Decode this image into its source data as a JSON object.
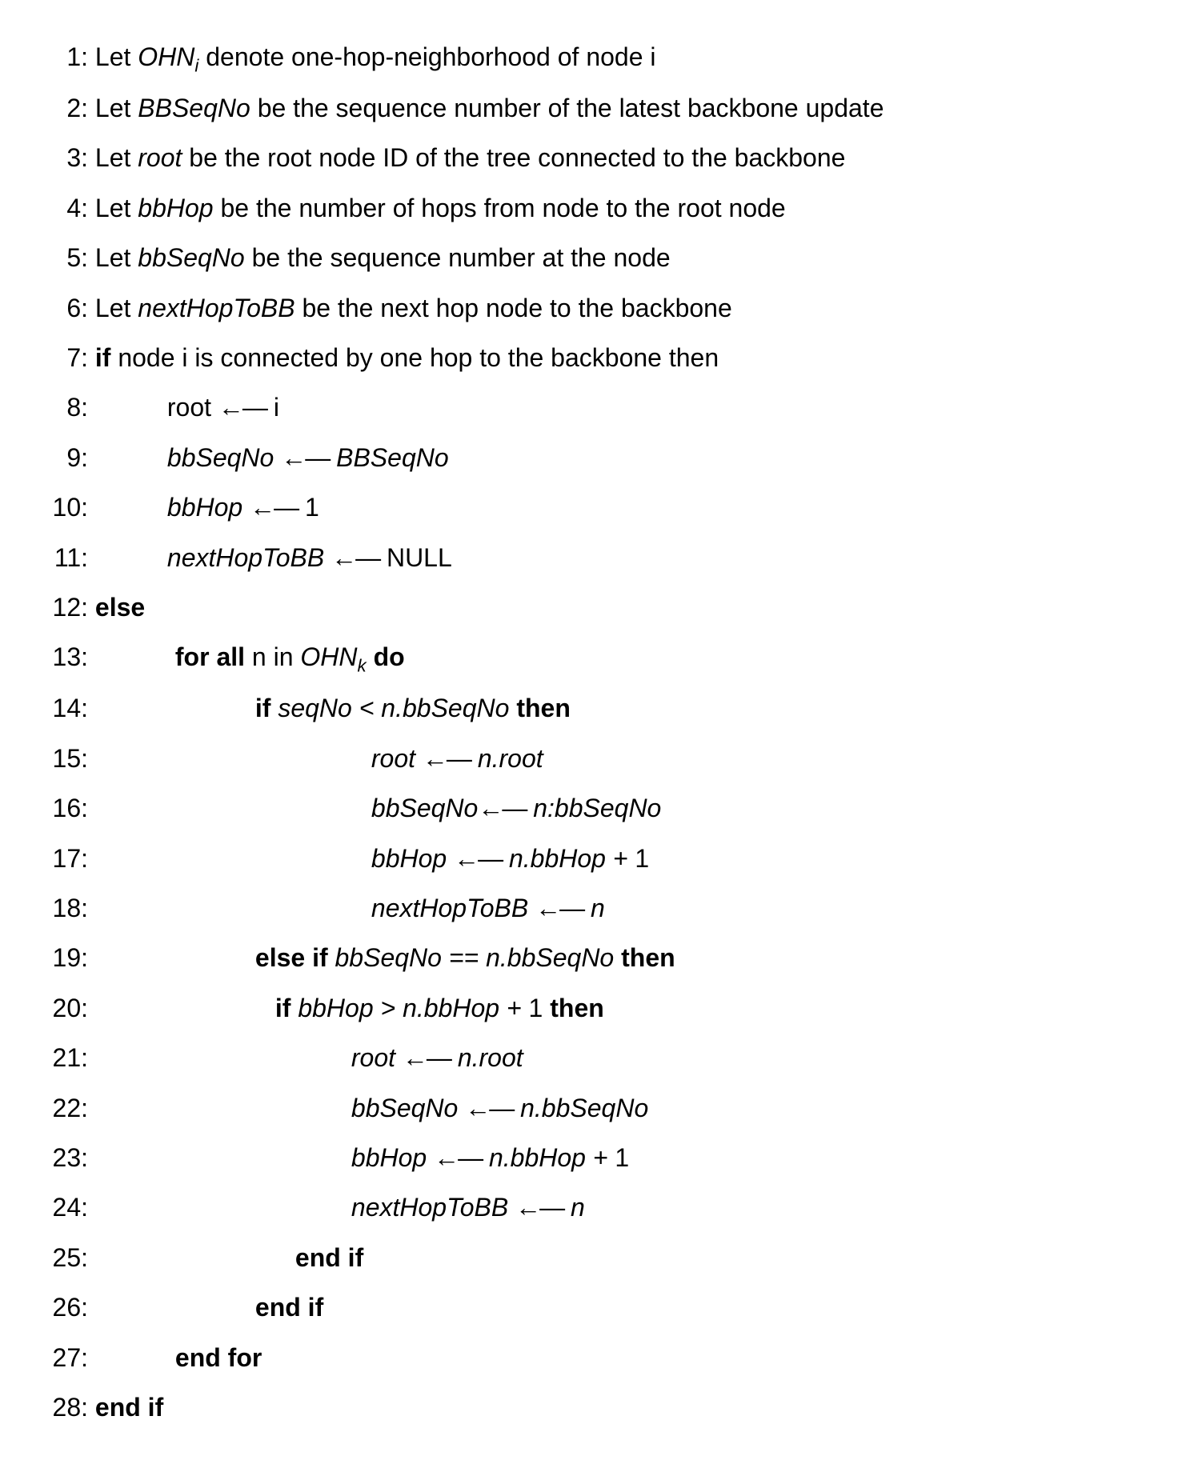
{
  "lines": {
    "l1": {
      "num": "1:",
      "a": "Let ",
      "b": "OHN",
      "sub": "i",
      "c": " denote one-hop-neighborhood of node i"
    },
    "l2": {
      "num": "2:",
      "a": "Let ",
      "b": "BBSeqNo",
      "c": " be the sequence number of the latest backbone update"
    },
    "l3": {
      "num": "3:",
      "a": "Let ",
      "b": "root",
      "c": " be the root node ID of the tree connected to the backbone"
    },
    "l4": {
      "num": "4:",
      "a": "Let ",
      "b": "bbHop",
      "c": " be the number of hops from node to the root node"
    },
    "l5": {
      "num": "5:",
      "a": "Let ",
      "b": "bbSeqNo",
      "c": " be the sequence number at the node"
    },
    "l6": {
      "num": "6:",
      "a": "Let ",
      "b": "nextHopToBB",
      "c": " be the next hop node to the backbone"
    },
    "l7": {
      "num": "7:",
      "a": "if",
      "b": " node i is connected by one hop to the backbone then"
    },
    "l8": {
      "num": "8:",
      "a": "root ",
      "b": " i"
    },
    "l9": {
      "num": "9:",
      "a": "bbSeqNo   ",
      "b": "   BBSeqNo"
    },
    "l10": {
      "num": "10:",
      "a": "bbHop ",
      "b": "   1"
    },
    "l11": {
      "num": "11:",
      "a": "nextHopToBB   ",
      "b": "   NULL"
    },
    "l12": {
      "num": "12:",
      "a": "else"
    },
    "l13": {
      "num": "13:",
      "a": "for all",
      "b": " n in ",
      "c": "OHN",
      "sub": "k",
      "d": " do"
    },
    "l14": {
      "num": "14:",
      "a": "if ",
      "b": "seqNo < n.bbSeqNo ",
      "c": "then"
    },
    "l15": {
      "num": "15:",
      "a": "root  ",
      "b": "   n.root"
    },
    "l16": {
      "num": "16:",
      "a": "bbSeqNo",
      "b": " n:bbSeqNo"
    },
    "l17": {
      "num": "17:",
      "a": "bbHop ",
      "b": " n.bbHop + ",
      "c": "1"
    },
    "l18": {
      "num": "18:",
      "a": "nextHopToBB  ",
      "b": "    n"
    },
    "l19": {
      "num": "19:",
      "a": "else if ",
      "b": "bbSeqNo == n.bbSeqNo ",
      "c": "then"
    },
    "l20": {
      "num": "20:",
      "a": "if ",
      "b": "bbHop > n.bbHop + ",
      "c": "1 ",
      "d": "then"
    },
    "l21": {
      "num": "21:",
      "a": "root  ",
      "b": "    n.root"
    },
    "l22": {
      "num": "22:",
      "a": "bbSeqNo  ",
      "b": "     n.bbSeqNo"
    },
    "l23": {
      "num": "23:",
      "a": "bbHop   ",
      "b": "    n.bbHop + ",
      "c": "1"
    },
    "l24": {
      "num": "24:",
      "a": "nextHopToBB  ",
      "b": "     n"
    },
    "l25": {
      "num": "25:",
      "a": "end if"
    },
    "l26": {
      "num": "26:",
      "a": "end if"
    },
    "l27": {
      "num": "27:",
      "a": "end for"
    },
    "l28": {
      "num": "28:",
      "a": "end if"
    }
  },
  "arrow": "←—"
}
